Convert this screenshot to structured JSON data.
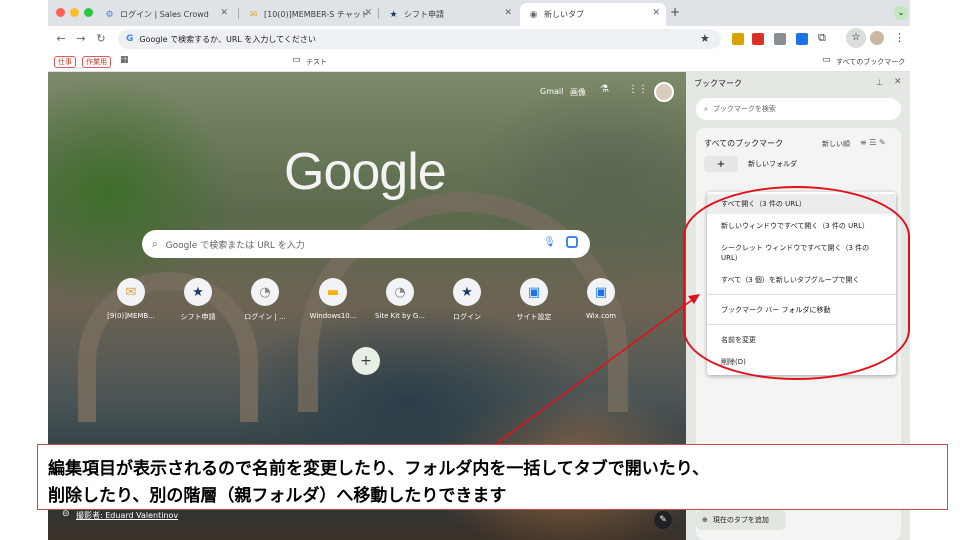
{
  "tabs": [
    {
      "label": "ログイン | Sales Crowd",
      "icon": "robot-icon"
    },
    {
      "label": "[10(0)]MEMBER-S チャット",
      "icon": "chat-icon"
    },
    {
      "label": "シフト申請",
      "icon": "star-icon"
    },
    {
      "label": "新しいタブ",
      "icon": "chrome-icon"
    }
  ],
  "toolbar": {
    "address_placeholder": "Google で検索するか、URL を入力してください"
  },
  "bookmarks_bar": {
    "chips": [
      "仕事",
      "作業用"
    ],
    "folder": "テスト",
    "all_bookmarks": "すべてのブックマーク"
  },
  "ntp": {
    "gmail": "Gmail",
    "images": "画像",
    "logo": "Google",
    "search_placeholder": "Google で検索または URL を入力",
    "shortcuts": [
      "[9(0)]MEMB...",
      "シフト申請",
      "ログイン | ...",
      "Windows10...",
      "Site Kit by G...",
      "ログイン",
      "サイト設定",
      "Wix.com"
    ],
    "credit": "撮影者: Eduard Valentinov"
  },
  "bookmark_panel": {
    "title": "ブックマーク",
    "search_placeholder": "ブックマークを検索",
    "all_bookmarks": "すべてのブックマーク",
    "sort": "新しい順",
    "new_folder": "新しいフォルダ",
    "add_current_tab": "現在のタブを追加"
  },
  "context_menu": [
    "すべて開く（3 件の URL）",
    "新しいウィンドウですべて開く（3 件の URL）",
    "シークレット ウィンドウですべて開く（3 件の URL）",
    "すべて（3 個）を新しいタブグループで開く",
    "ブックマーク バー フォルダに移動",
    "名前を変更",
    "削除(D)"
  ],
  "caption": {
    "line1": "編集項目が表示されるので名前を変更したり、フォルダ内を一括してタブで開いたり、",
    "line2": "削除したり、別の階層（親フォルダ）へ移動したりできます"
  },
  "colors": {
    "annotation_red": "#e3101c",
    "google_blue": "#4285f4"
  }
}
